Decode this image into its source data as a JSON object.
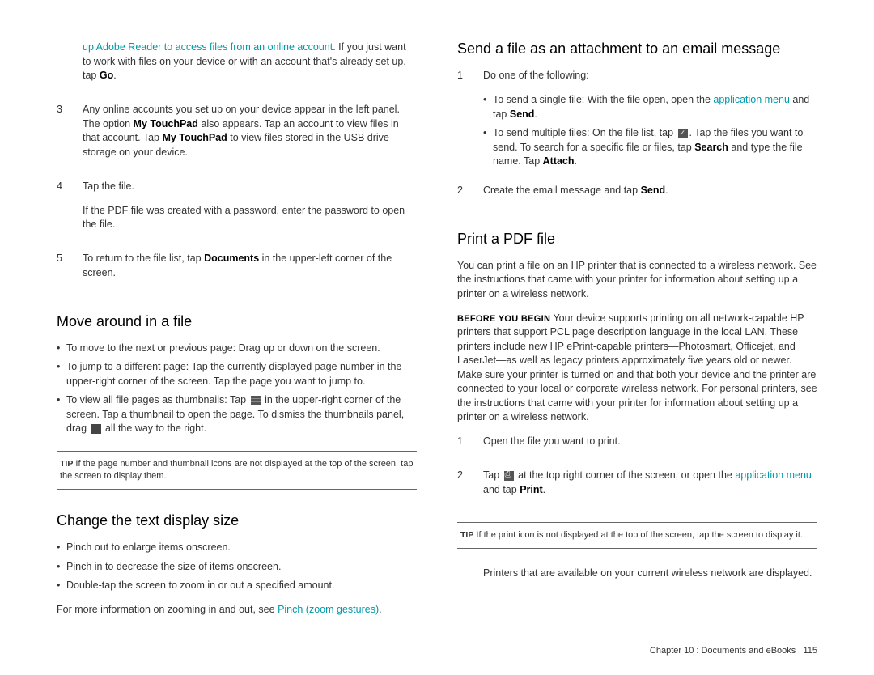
{
  "left": {
    "cont_link": "up Adobe Reader to access files from an online account",
    "cont_text1": ". If you just want to work with files on your device or with an account that's already set up, tap ",
    "cont_go": "Go",
    "step3_a": "Any online accounts you set up on your device appear in the left panel. The option ",
    "step3_b": "My TouchPad",
    "step3_c": " also appears. Tap an account to view files in that account. Tap ",
    "step3_d": "My TouchPad",
    "step3_e": " to view files stored in the USB drive storage on your device.",
    "step4_a": "Tap the file.",
    "step4_b": "If the PDF file was created with a password, enter the password to open the file.",
    "step5_a": "To return to the file list, tap ",
    "step5_b": "Documents",
    "step5_c": " in the upper-left corner of the screen.",
    "h_move": "Move around in a file",
    "move_b1": "To move to the next or previous page: Drag up or down on the screen.",
    "move_b2": "To jump to a different page: Tap the currently displayed page number in the upper-right corner of the screen. Tap the page you want to jump to.",
    "move_b3a": "To view all file pages as thumbnails: Tap ",
    "move_b3b": " in the upper-right corner of the screen. Tap a thumbnail to open the page. To dismiss the thumbnails panel, drag ",
    "move_b3c": " all the way to the right.",
    "tip1_lbl": "TIP",
    "tip1": " If the page number and thumbnail icons are not displayed at the top of the screen, tap the screen to display them.",
    "h_change": "Change the text display size",
    "ch1": "Pinch out to enlarge items onscreen.",
    "ch2": "Pinch in to decrease the size of items onscreen.",
    "ch3": "Double-tap the screen to zoom in or out a specified amount.",
    "more_a": "For more information on zooming in and out, see ",
    "more_link": "Pinch (zoom gestures)"
  },
  "right": {
    "h_send": "Send a file as an attachment to an email message",
    "s1": "Do one of the following:",
    "s1a_a": "To send a single file: With the file open, open the ",
    "s1a_link": "application menu",
    "s1a_b": " and tap ",
    "s1a_bold": "Send",
    "s1b_a": "To send multiple files: On the file list, tap ",
    "s1b_b": ". Tap the files you want to send. To search for a specific file or files, tap ",
    "s1b_bold1": "Search",
    "s1b_c": " and type the file name. Tap ",
    "s1b_bold2": "Attach",
    "s2_a": "Create the email message and tap ",
    "s2_b": "Send",
    "h_print": "Print a PDF file",
    "p_intro": "You can print a file on an HP printer that is connected to a wireless network. See the instructions that came with your printer for information about setting up a printer on a wireless network.",
    "begin_lbl": "BEFORE YOU BEGIN",
    "begin": " Your device supports printing on all network-capable HP printers that support PCL page description language in the local LAN. These printers include new HP ePrint-capable printers—Photosmart, Officejet, and LaserJet—as well as legacy printers approximately five years old or newer. Make sure your printer is turned on and that both your device and the printer are connected to your local or corporate wireless network. For personal printers, see the instructions that came with your printer for information about setting up a printer on a wireless network.",
    "p1": "Open the file you want to print.",
    "p2_a": "Tap ",
    "p2_b": " at the top right corner of the screen, or open the ",
    "p2_link": "application menu",
    "p2_c": " and tap ",
    "p2_bold": "Print",
    "tip2_lbl": "TIP",
    "tip2": " If the print icon is not displayed at the top of the screen, tap the screen to display it.",
    "p_after": "Printers that are available on your current wireless network are displayed."
  },
  "footer": {
    "chapter": "Chapter 10 : Documents and eBooks",
    "page": "115"
  }
}
